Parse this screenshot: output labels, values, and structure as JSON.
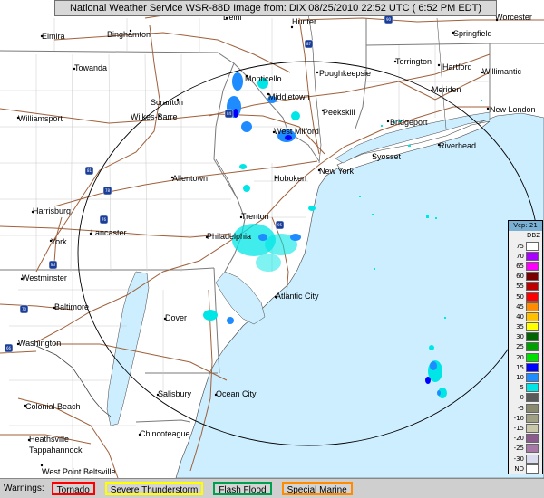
{
  "title": "National Weather Service WSR-88D Image from: DIX 08/25/2010 22:52 UTC ( 6:52 PM EDT)",
  "legend": {
    "vcp_label": "Vcp: 21",
    "unit": "DBZ",
    "levels": [
      {
        "label": "75",
        "color": "#ffffff"
      },
      {
        "label": "70",
        "color": "#aa00ff"
      },
      {
        "label": "65",
        "color": "#ff00ff"
      },
      {
        "label": "60",
        "color": "#7a0000"
      },
      {
        "label": "55",
        "color": "#bf0000"
      },
      {
        "label": "50",
        "color": "#ff0000"
      },
      {
        "label": "45",
        "color": "#ff8c00"
      },
      {
        "label": "40",
        "color": "#ffc000"
      },
      {
        "label": "35",
        "color": "#ffff00"
      },
      {
        "label": "30",
        "color": "#006400"
      },
      {
        "label": "25",
        "color": "#00a000"
      },
      {
        "label": "20",
        "color": "#00e000"
      },
      {
        "label": "15",
        "color": "#0000ff"
      },
      {
        "label": "10",
        "color": "#1e8cff"
      },
      {
        "label": "5",
        "color": "#00e6e6"
      },
      {
        "label": "0",
        "color": "#5a5a5a"
      },
      {
        "label": "-5",
        "color": "#8a8a6e"
      },
      {
        "label": "-10",
        "color": "#a0a082"
      },
      {
        "label": "-15",
        "color": "#c8c8a8"
      },
      {
        "label": "-20",
        "color": "#8c5a8c"
      },
      {
        "label": "-25",
        "color": "#a878a8"
      },
      {
        "label": "-30",
        "color": "#dcdcf0"
      },
      {
        "label": "ND",
        "color": "#ffffff"
      }
    ]
  },
  "warnings": {
    "label": "Warnings:",
    "items": [
      {
        "label": "Tornado",
        "color": "#ff0000"
      },
      {
        "label": "Severe Thunderstorm",
        "color": "#ffff00"
      },
      {
        "label": "Flash Flood",
        "color": "#00a050"
      },
      {
        "label": "Special Marine",
        "color": "#ff8c00"
      }
    ]
  },
  "cities": [
    "Elmira",
    "Binghamton",
    "Delhi",
    "Hunter",
    "Worcester",
    "Springfield",
    "Towanda",
    "Monticello",
    "Poughkeepsie",
    "Torrington",
    "Hartford",
    "Willimantic",
    "Middletown",
    "Meriden",
    "New London",
    "Scranton",
    "Wilkes-Barre",
    "Peekskill",
    "Williamsport",
    "West Milford",
    "Bridgeport",
    "Riverhead",
    "Syosset",
    "New York",
    "Allentown",
    "Hoboken",
    "Harrisburg",
    "Trenton",
    "Lancaster",
    "Philadelphia",
    "York",
    "Westminster",
    "Atlantic City",
    "Baltimore",
    "Dover",
    "Washington",
    "Salisbury",
    "Ocean City",
    "Colonial Beach",
    "Chincoteague",
    "Heathsville",
    "Tappahannock",
    "West Point",
    "Beltsville"
  ],
  "highways": [
    "88",
    "90",
    "87",
    "84",
    "81",
    "78",
    "76",
    "95",
    "83",
    "70",
    "66"
  ],
  "colors": {
    "land": "#ffffff",
    "ocean": "#cdeeff",
    "state_border": "#7a7a7a",
    "road": "#a0603a",
    "range_ring": "#000000"
  }
}
